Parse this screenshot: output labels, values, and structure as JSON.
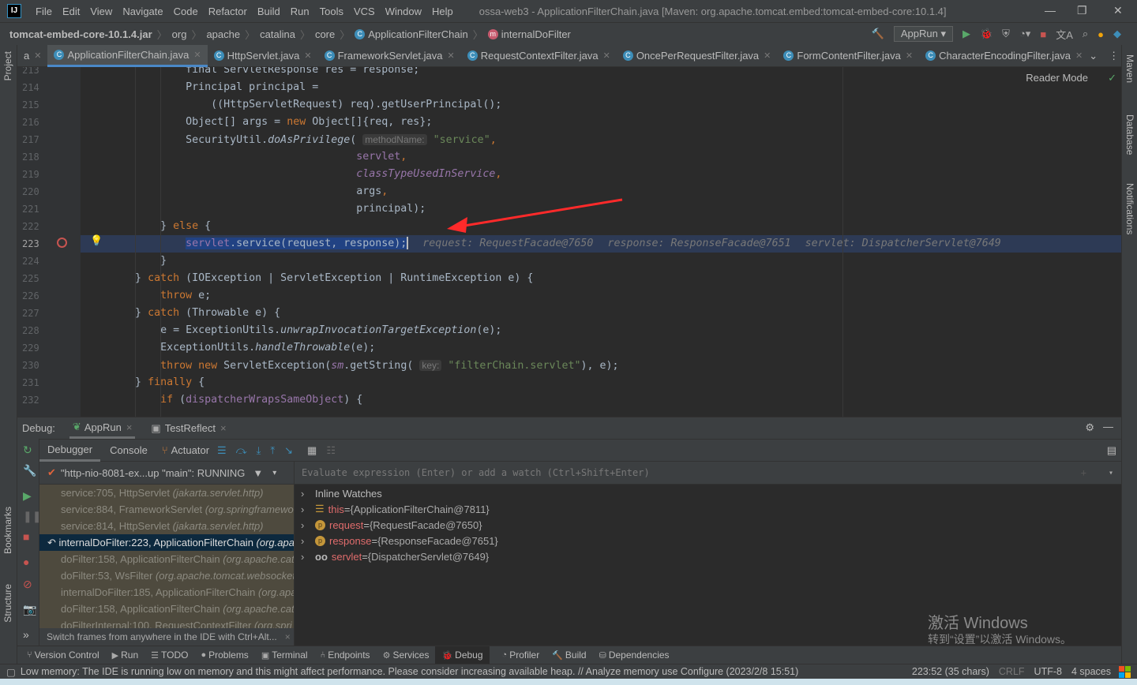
{
  "app": {
    "logo": "IJ",
    "title": "ossa-web3 - ApplicationFilterChain.java [Maven: org.apache.tomcat.embed:tomcat-embed-core:10.1.4]"
  },
  "menu": [
    "File",
    "Edit",
    "View",
    "Navigate",
    "Code",
    "Refactor",
    "Build",
    "Run",
    "Tools",
    "VCS",
    "Window",
    "Help"
  ],
  "breadcrumb": [
    "tomcat-embed-core-10.1.4.jar",
    "org",
    "apache",
    "catalina",
    "core",
    "ApplicationFilterChain",
    "internalDoFilter"
  ],
  "run_config": "AppRun",
  "tabs": [
    {
      "label": "a"
    },
    {
      "label": "ApplicationFilterChain.java",
      "active": true
    },
    {
      "label": "HttpServlet.java"
    },
    {
      "label": "FrameworkServlet.java"
    },
    {
      "label": "RequestContextFilter.java"
    },
    {
      "label": "OncePerRequestFilter.java"
    },
    {
      "label": "FormContentFilter.java"
    },
    {
      "label": "CharacterEncodingFilter.java"
    }
  ],
  "left_tools": [
    "Project",
    "Bookmarks",
    "Structure"
  ],
  "right_tools": [
    "Maven",
    "Database",
    "Notifications"
  ],
  "editor": {
    "reader_mode": "Reader Mode",
    "current_line": 223,
    "lines": [
      {
        "n": "213",
        "t": [
          [
            "p",
            "                final ServletResponse res = response;"
          ]
        ]
      },
      {
        "n": "214",
        "t": [
          [
            "p",
            "                Principal principal ="
          ]
        ]
      },
      {
        "n": "215",
        "t": [
          [
            "p",
            "                    ((HttpServletRequest) req).getUserPrincipal();"
          ]
        ]
      },
      {
        "n": "216",
        "t": [
          [
            "p",
            "                Object[] args = "
          ],
          [
            "k",
            "new"
          ],
          [
            "p",
            " Object[]{req, res};"
          ]
        ]
      },
      {
        "n": "217",
        "t": [
          [
            "p",
            "                SecurityUtil."
          ],
          [
            "i",
            "doAsPrivilege"
          ],
          [
            "p",
            "( "
          ],
          [
            "h",
            "methodName:"
          ],
          [
            "s",
            " \"service\""
          ],
          [
            "k",
            ","
          ]
        ]
      },
      {
        "n": "218",
        "t": [
          [
            "p",
            "                                           "
          ],
          [
            "f",
            "servlet"
          ],
          [
            "k",
            ","
          ]
        ]
      },
      {
        "n": "219",
        "t": [
          [
            "p",
            "                                           "
          ],
          [
            "fi",
            "classTypeUsedInService"
          ],
          [
            "k",
            ","
          ]
        ]
      },
      {
        "n": "220",
        "t": [
          [
            "p",
            "                                           args"
          ],
          [
            "k",
            ","
          ]
        ]
      },
      {
        "n": "221",
        "t": [
          [
            "p",
            "                                           principal);"
          ]
        ]
      },
      {
        "n": "222",
        "t": [
          [
            "p",
            "            } "
          ],
          [
            "k",
            "else"
          ],
          [
            "p",
            " {"
          ]
        ]
      },
      {
        "n": "223",
        "t": [
          [
            "p",
            "                "
          ],
          [
            "cf",
            "servlet"
          ],
          [
            "cp",
            ".service(request, response);"
          ]
        ],
        "inline": [
          "request: RequestFacade@7650",
          "response: ResponseFacade@7651",
          "servlet: DispatcherServlet@7649"
        ]
      },
      {
        "n": "224",
        "t": [
          [
            "p",
            "            }"
          ]
        ]
      },
      {
        "n": "225",
        "t": [
          [
            "p",
            "        } "
          ],
          [
            "k",
            "catch"
          ],
          [
            "p",
            " (IOException | ServletException | RuntimeException e) {"
          ]
        ]
      },
      {
        "n": "226",
        "t": [
          [
            "p",
            "            "
          ],
          [
            "k",
            "throw"
          ],
          [
            "p",
            " e;"
          ]
        ]
      },
      {
        "n": "227",
        "t": [
          [
            "p",
            "        } "
          ],
          [
            "k",
            "catch"
          ],
          [
            "p",
            " (Throwable e) {"
          ]
        ]
      },
      {
        "n": "228",
        "t": [
          [
            "p",
            "            e = ExceptionUtils."
          ],
          [
            "i",
            "unwrapInvocationTargetException"
          ],
          [
            "p",
            "(e);"
          ]
        ]
      },
      {
        "n": "229",
        "t": [
          [
            "p",
            "            ExceptionUtils."
          ],
          [
            "i",
            "handleThrowable"
          ],
          [
            "p",
            "(e);"
          ]
        ]
      },
      {
        "n": "230",
        "t": [
          [
            "p",
            "            "
          ],
          [
            "k",
            "throw new"
          ],
          [
            "p",
            " ServletException("
          ],
          [
            "fi",
            "sm"
          ],
          [
            "p",
            ".getString( "
          ],
          [
            "h",
            "key:"
          ],
          [
            "s",
            " \"filterChain.servlet\""
          ],
          [
            "p",
            "), e);"
          ]
        ]
      },
      {
        "n": "231",
        "t": [
          [
            "p",
            "        } "
          ],
          [
            "k",
            "finally"
          ],
          [
            "p",
            " {"
          ]
        ]
      },
      {
        "n": "232",
        "t": [
          [
            "p",
            "            "
          ],
          [
            "k",
            "if"
          ],
          [
            "p",
            " ("
          ],
          [
            "f",
            "dispatcherWrapsSameObject"
          ],
          [
            "p",
            ") {"
          ]
        ]
      }
    ]
  },
  "debug": {
    "label": "Debug:",
    "sessions": [
      {
        "label": "AppRun",
        "active": true
      },
      {
        "label": "TestReflect"
      }
    ],
    "tabs": [
      "Debugger",
      "Console",
      "Actuator"
    ],
    "thread": "\"http-nio-8081-ex...up \"main\": RUNNING",
    "frames": [
      {
        "m": "service:705, HttpServlet",
        "p": "(jakarta.servlet.http)"
      },
      {
        "m": "service:884, FrameworkServlet",
        "p": "(org.springframework"
      },
      {
        "m": "service:814, HttpServlet",
        "p": "(jakarta.servlet.http)"
      },
      {
        "m": "internalDoFilter:223, ApplicationFilterChain",
        "p": "(org.apache",
        "selected": true
      },
      {
        "m": "doFilter:158, ApplicationFilterChain",
        "p": "(org.apache.cat"
      },
      {
        "m": "doFilter:53, WsFilter",
        "p": "(org.apache.tomcat.websocket"
      },
      {
        "m": "internalDoFilter:185, ApplicationFilterChain",
        "p": "(org.apache"
      },
      {
        "m": "doFilter:158, ApplicationFilterChain",
        "p": "(org.apache.cat"
      },
      {
        "m": "doFilterInternal:100, RequestContextFilter",
        "p": "(org.spri"
      }
    ],
    "frames_hint": "Switch frames from anywhere in the IDE with Ctrl+Alt...",
    "eval_placeholder": "Evaluate expression (Enter) or add a watch (Ctrl+Shift+Enter)",
    "variables": [
      {
        "icon": "watches",
        "name": "Inline Watches",
        "value": ""
      },
      {
        "icon": "field-list-icon",
        "name": "this",
        "value": "{ApplicationFilterChain@7811}"
      },
      {
        "icon": "parameter-icon",
        "name": "request",
        "value": "{RequestFacade@7650}"
      },
      {
        "icon": "parameter-icon",
        "name": "response",
        "value": "{ResponseFacade@7651}"
      },
      {
        "icon": "watch-glasses-icon",
        "name": "servlet",
        "value": "{DispatcherServlet@7649}"
      }
    ]
  },
  "toolwindows": [
    "Version Control",
    "Run",
    "TODO",
    "Problems",
    "Terminal",
    "Endpoints",
    "Services",
    "Debug",
    "Profiler",
    "Build",
    "Dependencies"
  ],
  "active_toolwindow": "Debug",
  "status": {
    "message": "Low memory: The IDE is running low on memory and this might affect performance. Please consider increasing available heap. // Analyze memory use   Configure (2023/2/8 15:51)",
    "position": "223:52 (35 chars)",
    "line_sep": "CRLF",
    "encoding": "UTF-8",
    "indent": "4 spaces"
  },
  "watermark": {
    "line1": "激活 Windows",
    "line2": "转到“设置”以激活 Windows。"
  },
  "colors": {
    "keyword": "#cc7832",
    "string": "#6a8759",
    "field": "#9876aa",
    "selection": "#214283",
    "breakpoint": "#c75450",
    "annotation_arrow": "#ff2a2a"
  }
}
